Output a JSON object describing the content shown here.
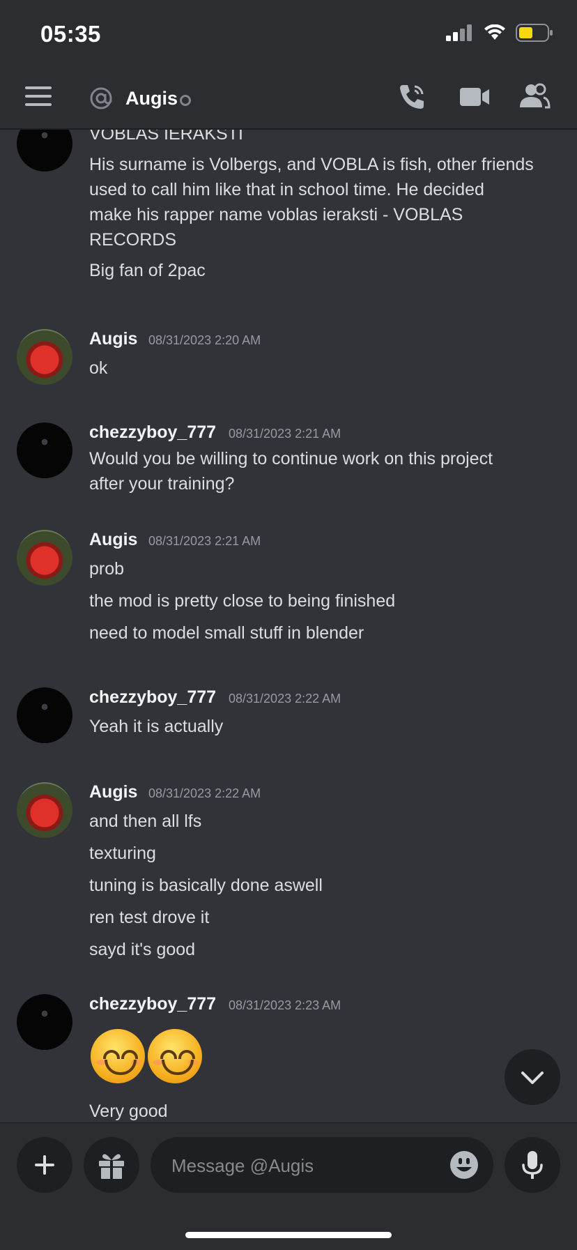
{
  "status_bar": {
    "time": "05:35"
  },
  "header": {
    "title": "Augis",
    "menu_icon": "menu-icon",
    "call_icon": "phone-call-icon",
    "video_icon": "video-camera-icon",
    "members_icon": "members-icon"
  },
  "messages": [
    {
      "continuation": true,
      "lines": [
        "VOBLAS IERAKSTI",
        "His surname is Volbergs, and VOBLA is fish, other friends",
        "used to call him like that in school time. He decided",
        "make his rapper name voblas ieraksti - VOBLAS",
        "RECORDS",
        "Big fan of 2pac"
      ]
    },
    {
      "user": "Augis",
      "timestamp": "08/31/2023 2:20 AM",
      "lines": [
        "ok"
      ]
    },
    {
      "user": "chezzyboy_777",
      "timestamp": "08/31/2023 2:21 AM",
      "lines": [
        "Would you be willing to continue work on this project",
        "after your training?"
      ]
    },
    {
      "user": "Augis",
      "timestamp": "08/31/2023 2:21 AM",
      "lines": [
        "prob",
        "the mod is pretty close to being finished",
        "need to model small stuff in blender"
      ]
    },
    {
      "user": "chezzyboy_777",
      "timestamp": "08/31/2023 2:22 AM",
      "lines": [
        "Yeah it is actually"
      ]
    },
    {
      "user": "Augis",
      "timestamp": "08/31/2023 2:22 AM",
      "lines": [
        "and then all lfs",
        "texturing",
        "tuning is basically done aswell",
        "ren test drove it",
        "sayd it's good"
      ]
    },
    {
      "user": "chezzyboy_777",
      "timestamp": "08/31/2023 2:23 AM",
      "emojis": [
        "smiling-face-emoji",
        "smiling-face-emoji"
      ],
      "lines": [
        "Very good"
      ]
    }
  ],
  "composer": {
    "placeholder": "Message @Augis",
    "plus_icon": "plus-icon",
    "gift_icon": "gift-icon",
    "emoji_icon": "emoji-icon",
    "mic_icon": "microphone-icon"
  },
  "colors": {
    "background": "#313338",
    "header": "#2b2d31",
    "input": "#1e1f22",
    "username": "#f2f3f5",
    "timestamp": "#949ba4",
    "battery": "#f5d90a"
  }
}
